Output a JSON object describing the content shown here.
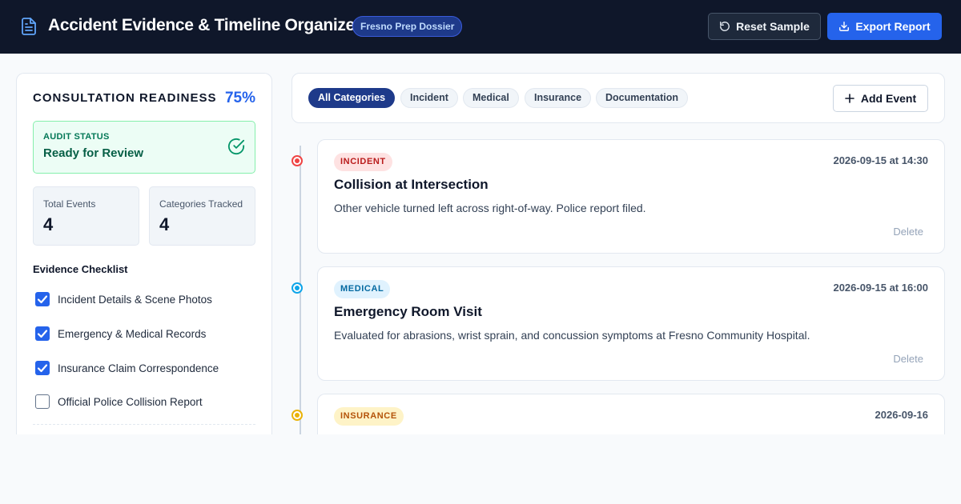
{
  "header": {
    "title": "Accident Evidence & Timeline Organizer",
    "badge": "Fresno Prep Dossier",
    "reset_label": "Reset Sample",
    "export_label": "Export Report"
  },
  "sidebar": {
    "readiness_title": "CONSULTATION READINESS",
    "readiness_percent": "75%",
    "audit_label": "AUDIT STATUS",
    "audit_value": "Ready for Review",
    "stats": [
      {
        "label": "Total Events",
        "value": "4"
      },
      {
        "label": "Categories Tracked",
        "value": "4"
      }
    ],
    "checklist_title": "Evidence Checklist",
    "checklist": [
      {
        "label": "Incident Details & Scene Photos",
        "checked": true
      },
      {
        "label": "Emergency & Medical Records",
        "checked": true
      },
      {
        "label": "Insurance Claim Correspondence",
        "checked": true
      },
      {
        "label": "Official Police Collision Report",
        "checked": false
      }
    ]
  },
  "filters": {
    "chips": [
      "All Categories",
      "Incident",
      "Medical",
      "Insurance",
      "Documentation"
    ],
    "active": "All Categories",
    "add_label": "Add Event"
  },
  "events": [
    {
      "tag": "INCIDENT",
      "time": "2026-09-15 at 14:30",
      "title": "Collision at Intersection",
      "description": "Other vehicle turned left across right-of-way. Police report filed.",
      "delete_label": "Delete"
    },
    {
      "tag": "MEDICAL",
      "time": "2026-09-15 at 16:00",
      "title": "Emergency Room Visit",
      "description": "Evaluated for abrasions, wrist sprain, and concussion symptoms at Fresno Community Hospital.",
      "delete_label": "Delete"
    },
    {
      "tag": "INSURANCE",
      "time": "2026-09-16"
    }
  ],
  "colors": {
    "header_bg": "#0f172a",
    "accent": "#2563eb",
    "incident": "#ef4444",
    "medical": "#0ea5e9",
    "insurance": "#eab308",
    "audit_green": "#047857"
  },
  "icons": {
    "logo": "document-icon",
    "reset": "reset-icon",
    "export": "download-icon",
    "audit": "check-circle-icon",
    "add": "plus-icon"
  }
}
